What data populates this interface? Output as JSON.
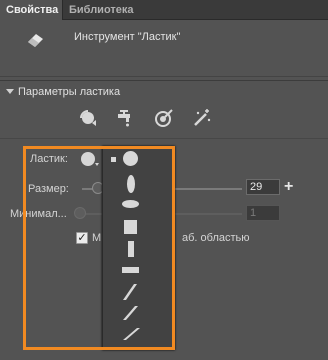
{
  "tabs": [
    {
      "label": "Свойства"
    },
    {
      "label": "Библиотека"
    }
  ],
  "tool": {
    "name": "Инструмент \"Ластик\""
  },
  "section": {
    "title": "Параметры ластика"
  },
  "mode_icons": [
    "erase-mode-icon",
    "faucet-icon",
    "target-icon",
    "wand-icon"
  ],
  "eraser": {
    "label": "Ластик:"
  },
  "size": {
    "label": "Размер:",
    "value": "29",
    "plus": "+"
  },
  "minimum": {
    "label": "Минимал...",
    "value": "1"
  },
  "checkbox": {
    "prefix": "М",
    "suffix": "аб. областью",
    "checked": true,
    "mark": "✓"
  },
  "shapes": [
    "small-square",
    "circle",
    "vertical-ellipse",
    "horizontal-ellipse",
    "square",
    "vertical-rect",
    "horizontal-rect",
    "slash-thin",
    "slash-medium",
    "slash-thick"
  ],
  "colors": {
    "accent": "#f18a22",
    "panel": "#535353",
    "popup": "#424242"
  }
}
